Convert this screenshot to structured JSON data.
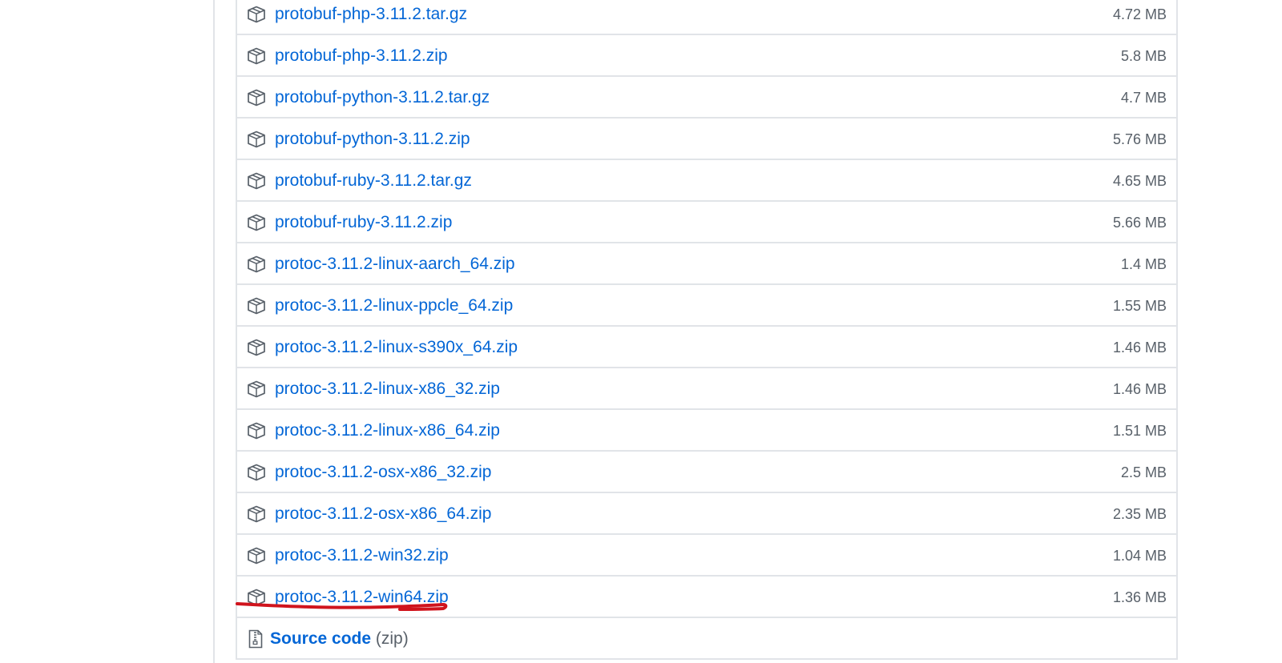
{
  "release": {
    "assets": [
      {
        "name": "protobuf-php-3.11.2.tar.gz",
        "size": "4.72 MB",
        "icon": "package-icon"
      },
      {
        "name": "protobuf-php-3.11.2.zip",
        "size": "5.8 MB",
        "icon": "package-icon"
      },
      {
        "name": "protobuf-python-3.11.2.tar.gz",
        "size": "4.7 MB",
        "icon": "package-icon"
      },
      {
        "name": "protobuf-python-3.11.2.zip",
        "size": "5.76 MB",
        "icon": "package-icon"
      },
      {
        "name": "protobuf-ruby-3.11.2.tar.gz",
        "size": "4.65 MB",
        "icon": "package-icon"
      },
      {
        "name": "protobuf-ruby-3.11.2.zip",
        "size": "5.66 MB",
        "icon": "package-icon"
      },
      {
        "name": "protoc-3.11.2-linux-aarch_64.zip",
        "size": "1.4 MB",
        "icon": "package-icon"
      },
      {
        "name": "protoc-3.11.2-linux-ppcle_64.zip",
        "size": "1.55 MB",
        "icon": "package-icon"
      },
      {
        "name": "protoc-3.11.2-linux-s390x_64.zip",
        "size": "1.46 MB",
        "icon": "package-icon"
      },
      {
        "name": "protoc-3.11.2-linux-x86_32.zip",
        "size": "1.46 MB",
        "icon": "package-icon"
      },
      {
        "name": "protoc-3.11.2-linux-x86_64.zip",
        "size": "1.51 MB",
        "icon": "package-icon"
      },
      {
        "name": "protoc-3.11.2-osx-x86_32.zip",
        "size": "2.5 MB",
        "icon": "package-icon"
      },
      {
        "name": "protoc-3.11.2-osx-x86_64.zip",
        "size": "2.35 MB",
        "icon": "package-icon"
      },
      {
        "name": "protoc-3.11.2-win32.zip",
        "size": "1.04 MB",
        "icon": "package-icon"
      },
      {
        "name": "protoc-3.11.2-win64.zip",
        "size": "1.36 MB",
        "icon": "package-icon",
        "highlighted": true
      }
    ],
    "source_code": {
      "label": "Source code",
      "format": "(zip)",
      "icon": "file-zip-icon"
    }
  },
  "colors": {
    "link": "#0366d6",
    "muted": "#586069",
    "border": "#e1e4e8",
    "annotation": "#d0141d"
  }
}
